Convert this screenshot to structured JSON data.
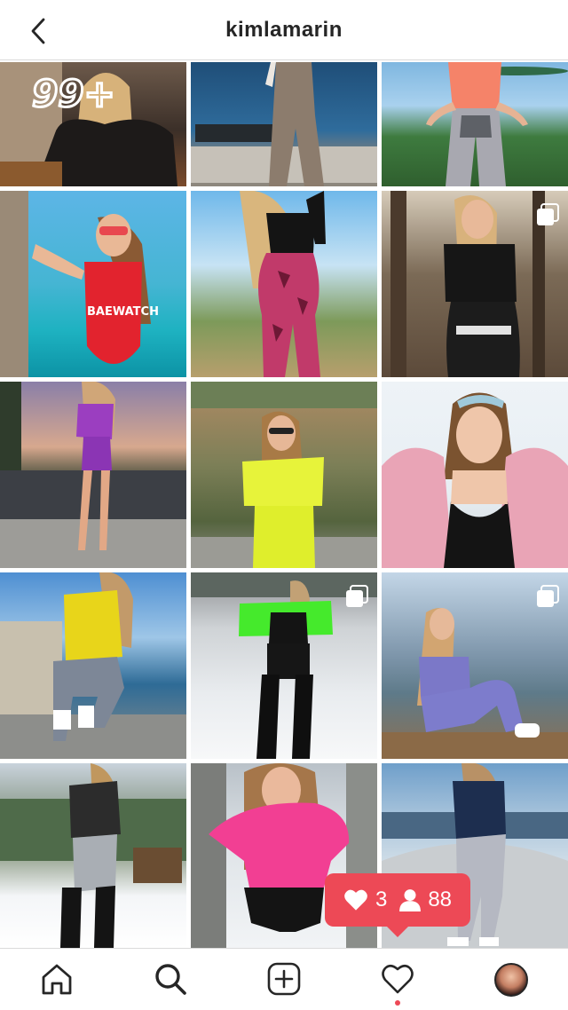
{
  "header": {
    "title": "kimlamarin",
    "back_icon": "chevron-left-icon"
  },
  "grid": {
    "tiles": [
      {
        "id": 1,
        "multi": false,
        "overlay_text": "99+"
      },
      {
        "id": 2,
        "multi": false
      },
      {
        "id": 3,
        "multi": false
      },
      {
        "id": 4,
        "multi": false,
        "overlay_text": "BAEWATCH"
      },
      {
        "id": 5,
        "multi": false
      },
      {
        "id": 6,
        "multi": true
      },
      {
        "id": 7,
        "multi": false
      },
      {
        "id": 8,
        "multi": false
      },
      {
        "id": 9,
        "multi": false
      },
      {
        "id": 10,
        "multi": false
      },
      {
        "id": 11,
        "multi": true
      },
      {
        "id": 12,
        "multi": true
      },
      {
        "id": 13,
        "multi": false
      },
      {
        "id": 14,
        "multi": false
      },
      {
        "id": 15,
        "multi": false
      }
    ]
  },
  "notification": {
    "likes": "3",
    "follows": "88",
    "color": "#ed4956"
  },
  "tabbar": {
    "items": [
      "home-icon",
      "search-icon",
      "new-post-icon",
      "activity-icon",
      "profile-avatar"
    ],
    "active_dot_color": "#ed4956"
  }
}
